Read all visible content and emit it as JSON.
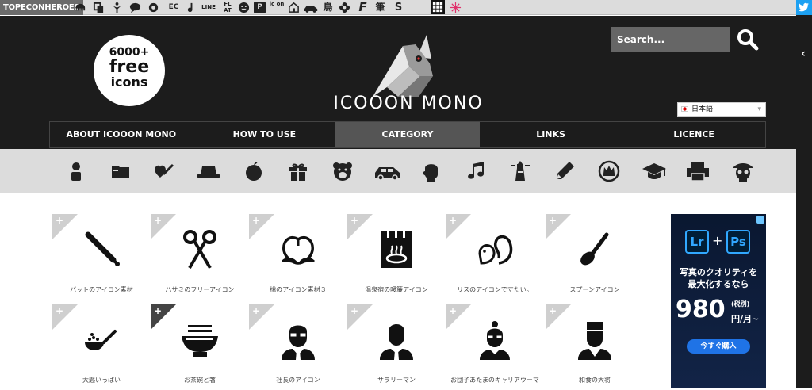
{
  "topbar": {
    "brand": "TOPECONHEROES",
    "tools": [
      {
        "name": "elephant-icon"
      },
      {
        "name": "copy-icon"
      },
      {
        "name": "person-icon"
      },
      {
        "name": "speech-bubble-icon"
      },
      {
        "name": "gear-flower-icon"
      },
      {
        "name": "ec-text",
        "label": "EC"
      },
      {
        "name": "music-note-icon"
      },
      {
        "name": "line-text",
        "label": "LINE"
      },
      {
        "name": "flat-text",
        "label": "FL AT"
      },
      {
        "name": "smiley-icon"
      },
      {
        "name": "parking-icon",
        "label": "P"
      },
      {
        "name": "icon-text",
        "label": "ic on"
      },
      {
        "name": "house-icon"
      },
      {
        "name": "car-icon"
      },
      {
        "name": "bird-kanji-icon",
        "label": "鳥"
      },
      {
        "name": "flower-icon"
      },
      {
        "name": "f-letter-icon",
        "label": "F"
      },
      {
        "name": "brush-kanji-icon",
        "label": "筆"
      },
      {
        "name": "s-text-icon",
        "label": "S"
      },
      {
        "name": "grid-icon"
      },
      {
        "name": "burst-icon"
      }
    ]
  },
  "header": {
    "badge": {
      "line1": "6000+",
      "line2": "free",
      "line3": "icons"
    },
    "title": "ICOOON MONO",
    "search_placeholder": "Search...",
    "language": "日本語"
  },
  "nav": [
    {
      "label": "ABOUT ICOOON MONO",
      "active": false
    },
    {
      "label": "HOW TO USE",
      "active": false
    },
    {
      "label": "CATEGORY",
      "active": true
    },
    {
      "label": "LINKS",
      "active": false
    },
    {
      "label": "LICENCE",
      "active": false
    }
  ],
  "categories": [
    "person-icon",
    "folder-icon",
    "heart-syringe-icon",
    "hat-icon",
    "apple-icon",
    "gift-icon",
    "bear-icon",
    "car-icon",
    "boxing-glove-icon",
    "music-note-icon",
    "lighthouse-icon",
    "pencil-icon",
    "crown-icon",
    "graduation-cap-icon",
    "printer-icon",
    "pirate-skull-icon"
  ],
  "cards": [
    {
      "label": "バットのアイコン素材",
      "icon": "baseball-bat-icon",
      "dark": false
    },
    {
      "label": "ハサミのフリーアイコン",
      "icon": "scissors-icon",
      "dark": false
    },
    {
      "label": "桃のアイコン素材３",
      "icon": "peach-icon",
      "dark": false
    },
    {
      "label": "温泉宿の暖簾アイコン",
      "icon": "onsen-noren-icon",
      "dark": false
    },
    {
      "label": "リスのアイコンですたい。",
      "icon": "squirrel-icon",
      "dark": false
    },
    {
      "label": "スプーンアイコン",
      "icon": "spoon-icon",
      "dark": false
    },
    {
      "label": "大匙いっぱい",
      "icon": "ladle-icon",
      "dark": false
    },
    {
      "label": "お茶碗と箸",
      "icon": "rice-bowl-icon",
      "dark": true
    },
    {
      "label": "社長のアイコン",
      "icon": "president-icon",
      "dark": false
    },
    {
      "label": "サラリーマン",
      "icon": "salaryman-icon",
      "dark": false
    },
    {
      "label": "お団子あたまのキャリアウーマ",
      "icon": "career-woman-icon",
      "dark": false
    },
    {
      "label": "和食の大将",
      "icon": "chef-icon",
      "dark": false
    }
  ],
  "ad": {
    "app1": "Lr",
    "app2": "Ps",
    "plus": "+",
    "headline1": "写真のクオリティを",
    "headline2": "最大化するなら",
    "price": "980",
    "tax": "(税別)",
    "per": "円/月~",
    "button": "今すぐ購入"
  }
}
